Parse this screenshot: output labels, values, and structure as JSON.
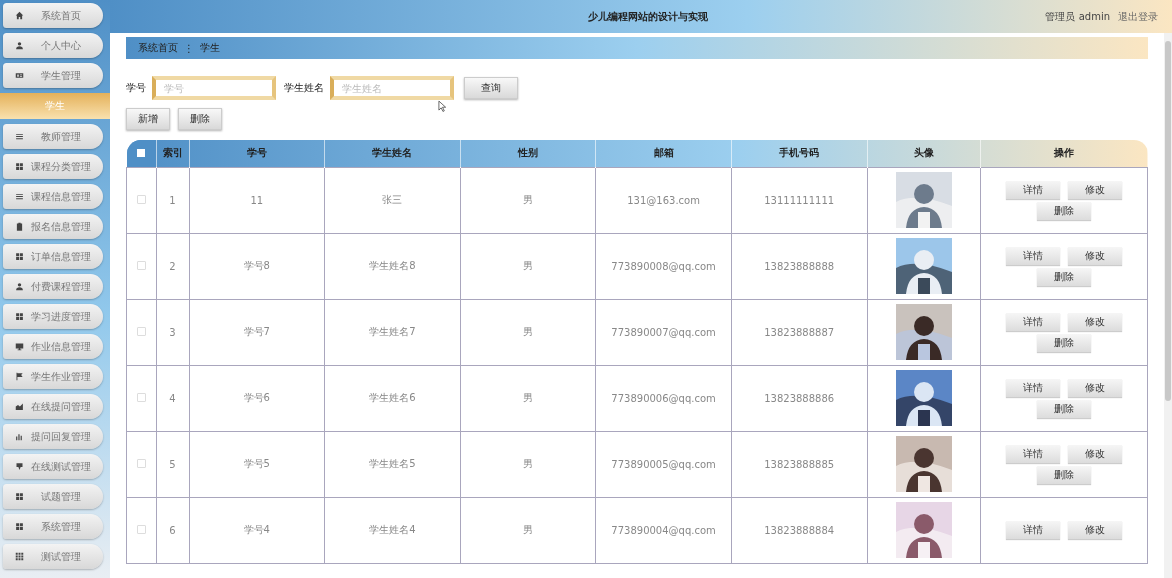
{
  "header": {
    "title": "少儿编程网站的设计与实现",
    "user": "管理员 admin",
    "logout": "退出登录"
  },
  "sidebar": {
    "items": [
      {
        "label": "系统首页",
        "kind": "home",
        "selected": false
      },
      {
        "label": "个人中心",
        "kind": "user",
        "selected": false
      },
      {
        "label": "学生管理",
        "kind": "card",
        "selected": false
      },
      {
        "label": "学生",
        "kind": "sub",
        "selected": true
      },
      {
        "label": "教师管理",
        "kind": "list",
        "selected": false
      },
      {
        "label": "课程分类管理",
        "kind": "grid",
        "selected": false
      },
      {
        "label": "课程信息管理",
        "kind": "list",
        "selected": false
      },
      {
        "label": "报名信息管理",
        "kind": "clipboard",
        "selected": false
      },
      {
        "label": "订单信息管理",
        "kind": "grid",
        "selected": false
      },
      {
        "label": "付费课程管理",
        "kind": "user",
        "selected": false
      },
      {
        "label": "学习进度管理",
        "kind": "grid",
        "selected": false
      },
      {
        "label": "作业信息管理",
        "kind": "monitor",
        "selected": false
      },
      {
        "label": "学生作业管理",
        "kind": "flag",
        "selected": false
      },
      {
        "label": "在线提问管理",
        "kind": "area",
        "selected": false
      },
      {
        "label": "提问回复管理",
        "kind": "bars",
        "selected": false
      },
      {
        "label": "在线测试管理",
        "kind": "pin",
        "selected": false
      },
      {
        "label": "试题管理",
        "kind": "grid",
        "selected": false
      },
      {
        "label": "系统管理",
        "kind": "grid",
        "selected": false
      },
      {
        "label": "测试管理",
        "kind": "grid9",
        "selected": false
      }
    ]
  },
  "breadcrumb": {
    "home": "系统首页",
    "separator": "⋮",
    "current": "学生"
  },
  "search": {
    "fields": [
      {
        "label": "学号",
        "placeholder": "学号"
      },
      {
        "label": "学生姓名",
        "placeholder": "学生姓名"
      }
    ],
    "button": "查询"
  },
  "actions": [
    "新增",
    "删除"
  ],
  "table": {
    "header_checked": false,
    "columns": [
      "索引",
      "学号",
      "学生姓名",
      "性别",
      "邮箱",
      "手机号码",
      "头像",
      "操作"
    ],
    "rows": [
      {
        "checked": false,
        "index": "1",
        "id": "11",
        "name": "张三",
        "gender": "男",
        "email": "131@163.com",
        "phone": "13111111111",
        "buttons": [
          "详情",
          "修改",
          "删除"
        ]
      },
      {
        "checked": false,
        "index": "2",
        "id": "学号8",
        "name": "学生姓名8",
        "gender": "男",
        "email": "773890008@qq.com",
        "phone": "13823888888",
        "buttons": [
          "详情",
          "修改",
          "删除"
        ]
      },
      {
        "checked": false,
        "index": "3",
        "id": "学号7",
        "name": "学生姓名7",
        "gender": "男",
        "email": "773890007@qq.com",
        "phone": "13823888887",
        "buttons": [
          "详情",
          "修改",
          "删除"
        ]
      },
      {
        "checked": false,
        "index": "4",
        "id": "学号6",
        "name": "学生姓名6",
        "gender": "男",
        "email": "773890006@qq.com",
        "phone": "13823888886",
        "buttons": [
          "详情",
          "修改",
          "删除"
        ]
      },
      {
        "checked": false,
        "index": "5",
        "id": "学号5",
        "name": "学生姓名5",
        "gender": "男",
        "email": "773890005@qq.com",
        "phone": "13823888885",
        "buttons": [
          "详情",
          "修改",
          "删除"
        ]
      },
      {
        "checked": false,
        "index": "6",
        "id": "学号4",
        "name": "学生姓名4",
        "gender": "男",
        "email": "773890004@qq.com",
        "phone": "13823888884",
        "buttons": [
          "详情",
          "修改"
        ]
      }
    ]
  }
}
